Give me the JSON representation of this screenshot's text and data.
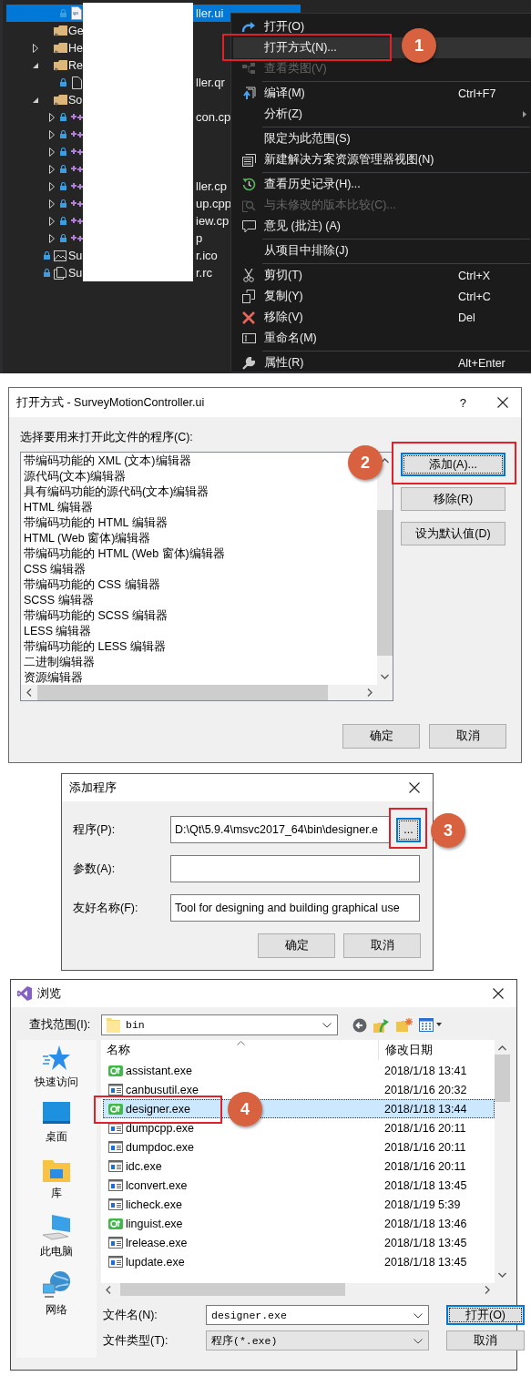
{
  "solution_explorer": {
    "continued_items": [
      {
        "kind": "ui",
        "tail": "ller.ui",
        "selected": true
      }
    ],
    "items": [
      {
        "kind": "folder",
        "label": "Ge",
        "selected": false
      },
      {
        "kind": "folder",
        "label": "He",
        "expanded": false,
        "selected": false
      },
      {
        "kind": "folder",
        "label": "Re",
        "expanded": true,
        "selected": false,
        "children": [
          {
            "kind": "file",
            "tail": "ller.qr",
            "selected": false
          }
        ]
      },
      {
        "kind": "folder",
        "label": "So",
        "expanded": true,
        "selected": false,
        "children": [
          {
            "kind": "cpp",
            "tail": "con.cp",
            "expanded": false,
            "selected": false
          },
          {
            "kind": "cpp",
            "expanded": false,
            "selected": false
          },
          {
            "kind": "cpp",
            "expanded": false,
            "selected": false
          },
          {
            "kind": "cpp",
            "expanded": false,
            "selected": false
          },
          {
            "kind": "cpp",
            "tail": "ller.cp",
            "expanded": false,
            "selected": false
          },
          {
            "kind": "cpp",
            "tail": "up.cpp",
            "expanded": false,
            "selected": false
          },
          {
            "kind": "cpp",
            "tail": "iew.cp",
            "expanded": false,
            "selected": false
          },
          {
            "kind": "cpp",
            "tail": "p",
            "expanded": false,
            "selected": false
          }
        ]
      },
      {
        "kind": "image",
        "label": "Su",
        "tail": "r.ico",
        "selected": false
      },
      {
        "kind": "resource",
        "label": "Su",
        "tail": "r.rc",
        "selected": false
      }
    ]
  },
  "context_menu": [
    {
      "kind": "item",
      "label": "打开(O)",
      "selected": false,
      "disabled": false,
      "submenu": false
    },
    {
      "kind": "item",
      "label": "打开方式(N)...",
      "selected": true,
      "disabled": false,
      "submenu": false
    },
    {
      "kind": "item",
      "label": "查看类图(V)",
      "selected": false,
      "disabled": true,
      "submenu": false
    },
    {
      "kind": "separator"
    },
    {
      "kind": "item",
      "label": "编译(M)",
      "shortcut": "Ctrl+F7",
      "selected": false,
      "disabled": false,
      "submenu": false
    },
    {
      "kind": "item",
      "label": "分析(Z)",
      "selected": false,
      "disabled": false,
      "submenu": true
    },
    {
      "kind": "separator"
    },
    {
      "kind": "item",
      "label": "限定为此范围(S)",
      "selected": false,
      "disabled": false,
      "submenu": false
    },
    {
      "kind": "item",
      "label": "新建解决方案资源管理器视图(N)",
      "selected": false,
      "disabled": false,
      "submenu": false
    },
    {
      "kind": "separator"
    },
    {
      "kind": "item",
      "label": "查看历史记录(H)...",
      "selected": false,
      "disabled": false,
      "submenu": false
    },
    {
      "kind": "item",
      "label": "与未修改的版本比较(C)...",
      "selected": false,
      "disabled": true,
      "submenu": false
    },
    {
      "kind": "item",
      "label": "意见 (批注) (A)",
      "selected": false,
      "disabled": false,
      "submenu": false
    },
    {
      "kind": "separator"
    },
    {
      "kind": "item",
      "label": "从项目中排除(J)",
      "selected": false,
      "disabled": false,
      "submenu": false
    },
    {
      "kind": "separator"
    },
    {
      "kind": "item",
      "label": "剪切(T)",
      "shortcut": "Ctrl+X",
      "selected": false,
      "disabled": false,
      "submenu": false
    },
    {
      "kind": "item",
      "label": "复制(Y)",
      "shortcut": "Ctrl+C",
      "selected": false,
      "disabled": false,
      "submenu": false
    },
    {
      "kind": "item",
      "label": "移除(V)",
      "shortcut": "Del",
      "selected": false,
      "disabled": false,
      "submenu": false
    },
    {
      "kind": "item",
      "label": "重命名(M)",
      "selected": false,
      "disabled": false,
      "submenu": false
    },
    {
      "kind": "separator"
    },
    {
      "kind": "item",
      "label": "属性(R)",
      "shortcut": "Alt+Enter",
      "selected": false,
      "disabled": false,
      "submenu": false
    }
  ],
  "open_with_dialog": {
    "title": "打开方式 - SurveyMotionController.ui",
    "help": "?",
    "prompt": "选择要用来打开此文件的程序(C):",
    "programs": [
      "带编码功能的 XML (文本)编辑器",
      "源代码(文本)编辑器",
      "具有编码功能的源代码(文本)编辑器",
      "HTML 编辑器",
      "带编码功能的 HTML 编辑器",
      "HTML (Web 窗体)编辑器",
      "带编码功能的 HTML (Web 窗体)编辑器",
      "CSS 编辑器",
      "带编码功能的 CSS 编辑器",
      "SCSS 编辑器",
      "带编码功能的 SCSS 编辑器",
      "LESS 编辑器",
      "带编码功能的 LESS 编辑器",
      "二进制编辑器",
      "资源编辑器"
    ],
    "side_buttons": [
      {
        "label": "添加(A)...",
        "focused": true
      },
      {
        "label": "移除(R)",
        "focused": false
      },
      {
        "label": "设为默认值(D)",
        "focused": false
      }
    ],
    "buttons": [
      "确定",
      "取消"
    ]
  },
  "add_program_dialog": {
    "title": "添加程序",
    "fields": [
      {
        "label": "程序(P):",
        "value": "D:\\Qt\\5.9.4\\msvc2017_64\\bin\\designer.e",
        "browse": "..."
      },
      {
        "label": "参数(A):"
      },
      {
        "label": "友好名称(F):",
        "value": "Tool for designing and building graphical use"
      }
    ],
    "buttons": [
      "确定",
      "取消"
    ]
  },
  "browse_dialog": {
    "title": "浏览",
    "look_in_label": "查找范围(I):",
    "look_in": "bin",
    "places": [
      {
        "kind": "quick-access",
        "label": "快速访问"
      },
      {
        "kind": "desktop",
        "label": "桌面"
      },
      {
        "kind": "library",
        "label": "库"
      },
      {
        "kind": "computer",
        "label": "此电脑"
      },
      {
        "kind": "network",
        "label": "网络"
      }
    ],
    "columns": [
      "名称",
      "修改日期"
    ],
    "files": [
      {
        "kind": "qt",
        "name": "assistant.exe",
        "modified": "2018/1/18 13:41",
        "selected": false
      },
      {
        "kind": "exe",
        "name": "canbusutil.exe",
        "modified": "2018/1/16 20:32",
        "selected": false
      },
      {
        "kind": "qt",
        "name": "designer.exe",
        "modified": "2018/1/18 13:44",
        "selected": true
      },
      {
        "kind": "exe",
        "name": "dumpcpp.exe",
        "modified": "2018/1/16 20:11",
        "selected": false
      },
      {
        "kind": "exe",
        "name": "dumpdoc.exe",
        "modified": "2018/1/16 20:11",
        "selected": false
      },
      {
        "kind": "exe",
        "name": "idc.exe",
        "modified": "2018/1/16 20:11",
        "selected": false
      },
      {
        "kind": "exe",
        "name": "lconvert.exe",
        "modified": "2018/1/18 13:45",
        "selected": false
      },
      {
        "kind": "exe",
        "name": "licheck.exe",
        "modified": "2018/1/19 5:39",
        "selected": false
      },
      {
        "kind": "qt",
        "name": "linguist.exe",
        "modified": "2018/1/18 13:46",
        "selected": false
      },
      {
        "kind": "exe",
        "name": "lrelease.exe",
        "modified": "2018/1/18 13:45",
        "selected": false
      },
      {
        "kind": "exe",
        "name": "lupdate.exe",
        "modified": "2018/1/18 13:45",
        "selected": false
      }
    ],
    "file_name_label": "文件名(N):",
    "file_name": "designer.exe",
    "file_type_label": "文件类型(T):",
    "file_type": "程序(*.exe)",
    "buttons": [
      "打开(O)",
      "取消"
    ]
  },
  "callouts": [
    {
      "number": "1"
    },
    {
      "number": "2"
    },
    {
      "number": "3"
    },
    {
      "number": "4"
    }
  ]
}
